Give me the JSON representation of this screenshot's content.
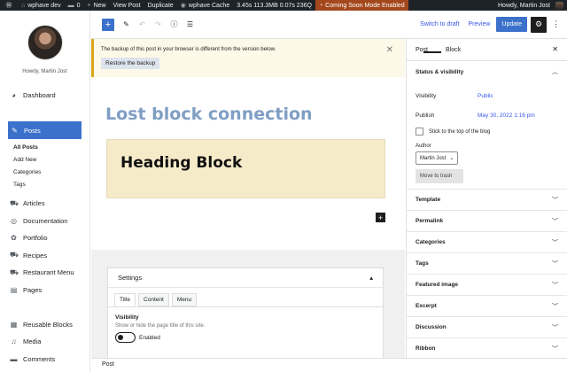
{
  "adminbar": {
    "site_name": "wphave dev",
    "comments_count": "0",
    "new_label": "New",
    "view_post_label": "View Post",
    "duplicate_label": "Duplicate",
    "cache_label": "wphave Cache",
    "stats": "3.45s  113.3MB  0.07s  236Q",
    "coming_soon": "Coming Soon Mode Enabled",
    "howdy": "Howdy, Martin Jost"
  },
  "sidebar": {
    "howdy": "Howdy, Martin Jost",
    "items": [
      {
        "label": "Dashboard",
        "icon": "dashboard-icon"
      },
      {
        "label": "Posts",
        "icon": "pin-icon"
      },
      {
        "label": "Articles",
        "icon": "cart-icon"
      },
      {
        "label": "Documentation",
        "icon": "globe-icon"
      },
      {
        "label": "Portfolio",
        "icon": "portfolio-icon"
      },
      {
        "label": "Recipes",
        "icon": "recipe-icon"
      },
      {
        "label": "Restaurant Menu",
        "icon": "cart-icon"
      },
      {
        "label": "Pages",
        "icon": "pages-icon"
      },
      {
        "label": "Reusable Blocks",
        "icon": "blocks-icon"
      },
      {
        "label": "Media",
        "icon": "media-icon"
      },
      {
        "label": "Comments",
        "icon": "comments-icon"
      }
    ],
    "subitems": [
      "All Posts",
      "Add New",
      "Categories",
      "Tags"
    ]
  },
  "toolbar": {
    "switch_draft": "Switch to draft",
    "preview": "Preview",
    "update": "Update"
  },
  "notice": {
    "message": "The backup of this post in your browser is different from the version below.",
    "restore": "Restore the backup"
  },
  "editor": {
    "post_title": "Lost block connection",
    "heading_block": "Heading Block"
  },
  "meta": {
    "title": "Settings",
    "tabs": [
      "Title",
      "Content",
      "Menu"
    ],
    "field_title": "Visibility",
    "field_desc": "Show or hide the page title of this site.",
    "toggle_label": "Enabled"
  },
  "footer": {
    "breadcrumb": "Post"
  },
  "panel": {
    "tab_post": "Post",
    "tab_block": "Block",
    "status_title": "Status & visibility",
    "visibility_label": "Visibility",
    "visibility_value": "Public",
    "publish_label": "Publish",
    "publish_value": "May 30, 2022 1:16 pm",
    "sticky_label": "Stick to the top of the blog",
    "author_label": "Author",
    "author_value": "Martin Jost",
    "trash": "Move to trash",
    "sections": [
      "Template",
      "Permalink",
      "Categories",
      "Tags",
      "Featured image",
      "Excerpt",
      "Discussion",
      "Ribbon"
    ]
  }
}
